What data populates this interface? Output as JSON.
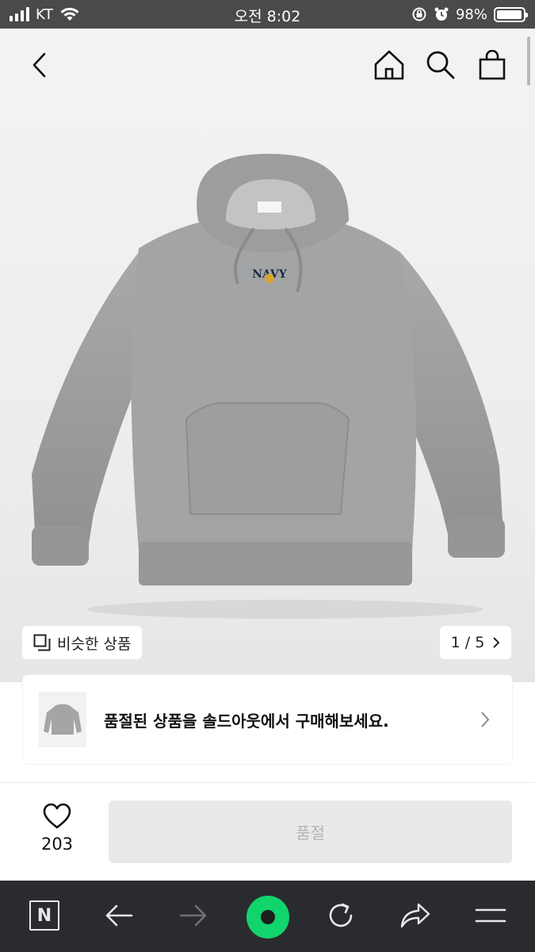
{
  "status_bar": {
    "carrier": "KT",
    "time": "오전 8:02",
    "battery_percent": "98%",
    "battery_level": 0.98,
    "icons": [
      "signal-icon",
      "wifi-icon",
      "orientation-lock-icon",
      "alarm-icon",
      "battery-icon"
    ]
  },
  "top_nav": {
    "icons": [
      "back-icon",
      "home-icon",
      "search-icon",
      "shopping-bag-icon"
    ]
  },
  "product": {
    "image_desc_icon": "grey-hoodie-photo",
    "similar_label": "비슷한 상품",
    "image_counter": "1 / 5"
  },
  "soldout_banner": {
    "text": "품절된 상품을 솔드아웃에서 구매해보세요."
  },
  "buy_bar": {
    "like_count": "203",
    "action_label": "품절"
  },
  "browser_bar": {
    "naver_label": "N",
    "icons": [
      "naver-home-icon",
      "back-arrow-icon",
      "forward-arrow-icon",
      "green-dot-icon",
      "refresh-icon",
      "share-icon",
      "menu-icon"
    ]
  },
  "colors": {
    "status_bar_bg": "#4a4a4a",
    "browser_bar_bg": "#292b2e",
    "accent_green": "#11d46d",
    "soldout_button_bg": "#e9e9e9"
  }
}
